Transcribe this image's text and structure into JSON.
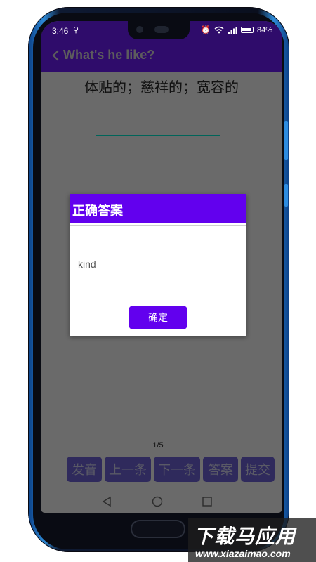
{
  "statusbar": {
    "time": "3:46",
    "usb_icon": "usb-icon",
    "right_text": "84%",
    "icons": [
      "alarm-icon",
      "wifi-icon",
      "signal-icon",
      "battery-icon"
    ]
  },
  "appbar": {
    "title": "What's he like?",
    "back_icon": "chevron-left-icon"
  },
  "question": {
    "text": "体贴的；慈祥的；宽容的"
  },
  "dialog": {
    "title": "正确答案",
    "message": "kind",
    "ok_label": "确定"
  },
  "progress": {
    "counter": "1/5"
  },
  "actions": {
    "pronounce": "发音",
    "previous": "上一条",
    "next": "下一条",
    "answer": "答案",
    "submit": "提交"
  },
  "navbar": {
    "icons": [
      "triangle-back-icon",
      "circle-home-icon",
      "square-recent-icon"
    ]
  },
  "watermark": {
    "main": "下载马应用",
    "sub": "www.xiazaimao.com"
  },
  "colors": {
    "appbar": "#2f0c6b",
    "dialog_accent": "#6200ee",
    "button_bg": "#2f2a5c",
    "screen_bg": "#6a6a6a",
    "input_line": "#00655a"
  }
}
